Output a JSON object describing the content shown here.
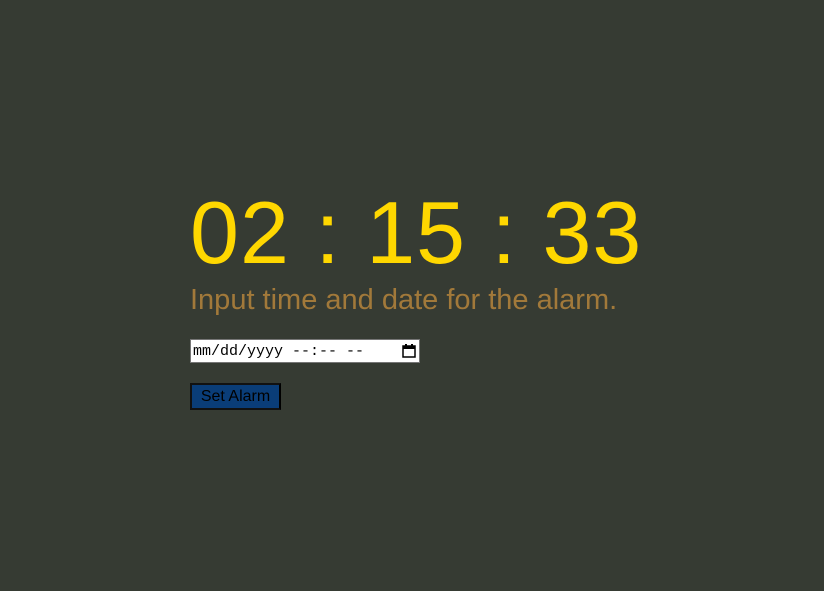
{
  "clock": {
    "display": "02 : 15 : 33"
  },
  "instruction": "Input time and date for the alarm.",
  "alarm_input": {
    "placeholder": "mm/dd/yyyy --:-- --",
    "icon": "calendar-icon"
  },
  "set_alarm_button": {
    "label": "Set Alarm"
  },
  "colors": {
    "background": "#363b33",
    "clock": "#ffd700",
    "instruction": "#a2793a",
    "button": "#0a3d78"
  }
}
